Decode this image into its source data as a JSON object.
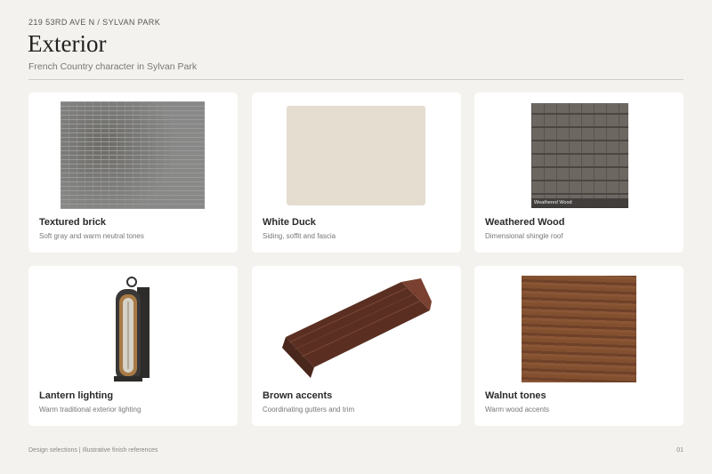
{
  "header": {
    "eyebrow": "219 53RD AVE N  /  SYLVAN PARK",
    "title": "Exterior",
    "subtitle": "French Country character in Sylvan Park"
  },
  "cards": [
    {
      "name": "Textured brick",
      "desc": "Soft gray and warm neutral tones"
    },
    {
      "name": "White Duck",
      "desc": "Siding, soffit and fascia",
      "swatch_color": "#e4ddd0"
    },
    {
      "name": "Weathered Wood",
      "desc": "Dimensional shingle roof",
      "image_caption": "Weathered Wood"
    },
    {
      "name": "Lantern lighting",
      "desc": "Warm traditional exterior lighting"
    },
    {
      "name": "Brown accents",
      "desc": "Coordinating gutters and trim"
    },
    {
      "name": "Walnut tones",
      "desc": "Warm wood accents"
    }
  ],
  "footer": {
    "left": "Design selections | Illustrative finish references",
    "right": "01"
  }
}
